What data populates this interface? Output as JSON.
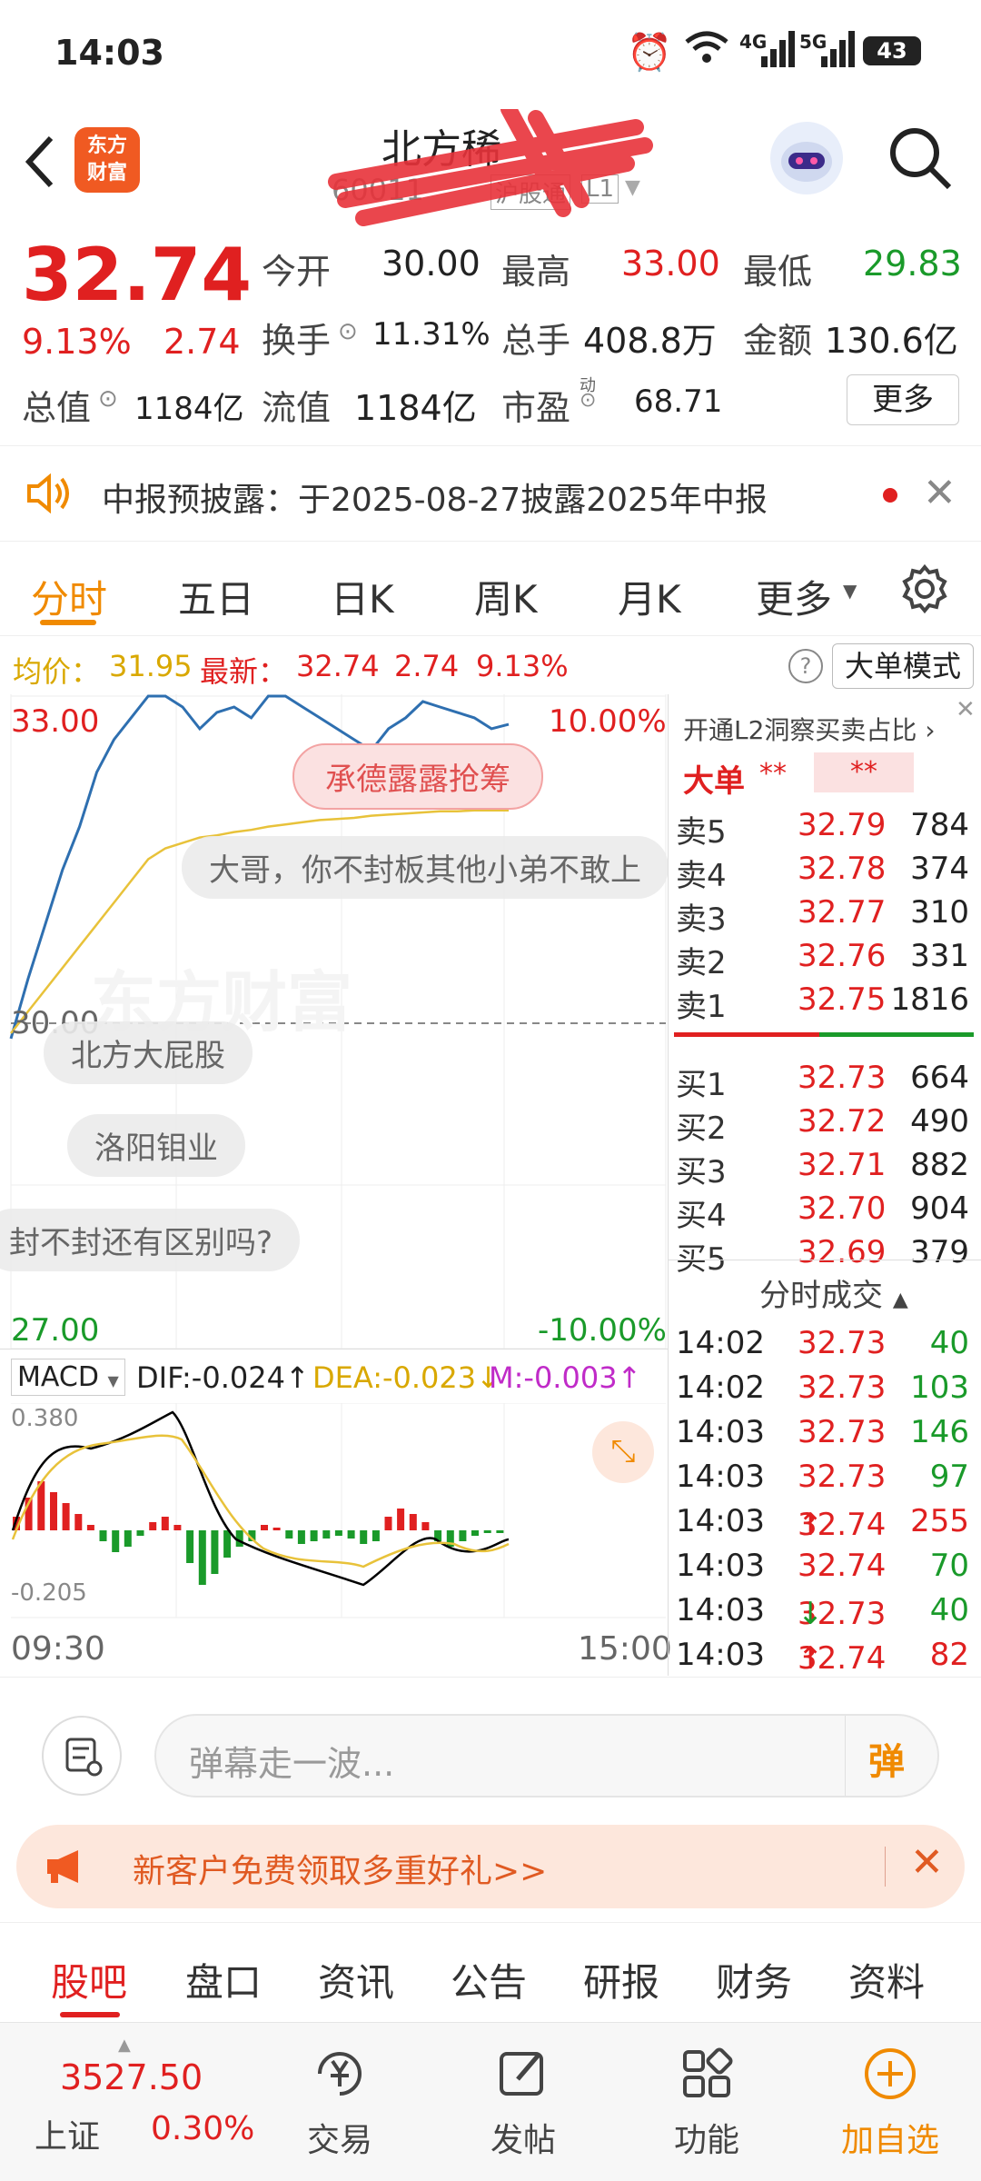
{
  "status": {
    "time": "14:03",
    "net1": "4G",
    "net2": "5G",
    "battery": "43"
  },
  "header": {
    "title": "北方稀",
    "code": "60011",
    "exchange": "沪股通",
    "level": "L1"
  },
  "quote": {
    "price": "32.74",
    "change_pct": "9.13%",
    "change": "2.74",
    "open_label": "今开",
    "open": "30.00",
    "high_label": "最高",
    "high": "33.00",
    "low_label": "最低",
    "low": "29.83",
    "turnover_label": "换手",
    "turnover": "11.31%",
    "volume_label": "总手",
    "volume": "408.8万",
    "amount_label": "金额",
    "amount": "130.6亿",
    "mktcap_label": "总值",
    "mktcap": "1184亿",
    "float_label": "流值",
    "float": "1184亿",
    "pe_label": "市盈",
    "pe_sup": "动",
    "pe": "68.71",
    "more_button": "更多"
  },
  "notice": {
    "text": "中报预披露：于2025-08-27披露2025年中报"
  },
  "ktabs": {
    "items": [
      "分时",
      "五日",
      "日K",
      "周K",
      "月K",
      "更多"
    ],
    "active": 0
  },
  "infobar": {
    "avg_label": "均价：",
    "avg": "31.95",
    "latest_label": "最新：",
    "latest": "32.74",
    "chg": "2.74",
    "pct": "9.13%",
    "mode_button": "大单模式"
  },
  "chart_data": {
    "type": "line",
    "y_top": "33.00",
    "y_mid": "30.00",
    "y_bottom": "27.00",
    "pct_top": "10.00%",
    "pct_bottom": "-10.00%",
    "x_start": "09:30",
    "x_end": "15:00",
    "ylim": [
      27.0,
      33.0
    ],
    "series": [
      {
        "values": [
          29.85,
          30.4,
          30.9,
          31.4,
          31.8,
          32.3,
          32.6,
          32.8,
          33.0,
          33.0,
          32.9,
          32.7,
          32.85,
          32.9,
          32.8,
          33.0,
          33.0,
          32.9,
          32.8,
          32.7,
          32.6,
          32.5,
          32.7,
          32.8,
          32.95,
          32.9,
          32.85,
          32.8,
          32.7,
          32.74
        ]
      },
      {
        "values": [
          29.9,
          30.1,
          30.3,
          30.5,
          30.7,
          30.9,
          31.1,
          31.3,
          31.5,
          31.6,
          31.65,
          31.7,
          31.72,
          31.75,
          31.77,
          31.8,
          31.82,
          31.84,
          31.86,
          31.87,
          31.88,
          31.9,
          31.91,
          31.92,
          31.93,
          31.94,
          31.94,
          31.95,
          31.95,
          31.95
        ]
      }
    ],
    "macd": {
      "label": "MACD",
      "dif": "DIF:-0.024",
      "dea": "DEA:-0.023",
      "m": "M:-0.003",
      "top": "0.380",
      "bottom": "-0.205",
      "bars": [
        0.05,
        0.12,
        0.18,
        0.14,
        0.1,
        0.06,
        0.02,
        -0.04,
        -0.08,
        -0.06,
        -0.02,
        0.03,
        0.05,
        0.02,
        -0.12,
        -0.2,
        -0.16,
        -0.1,
        -0.06,
        -0.04,
        0.02,
        0.01,
        -0.03,
        -0.05,
        -0.04,
        -0.03,
        -0.02,
        -0.03,
        -0.05,
        -0.04,
        0.05,
        0.08,
        0.06,
        0.03,
        -0.04,
        -0.06,
        -0.04,
        -0.02,
        -0.01,
        -0.01
      ]
    }
  },
  "danmaku": {
    "tag": "承德露露抢筹",
    "c1": "大哥，你不封板其他小弟不敢上",
    "c2": "北方大屁股",
    "c3": "洛阳钼业",
    "c4": "封不封还有区别吗?",
    "watermark": "东方财富"
  },
  "orderbook": {
    "title": "开通L2洞察买卖占比",
    "big_label": "大单",
    "big_v1": "**",
    "big_v2": "**",
    "asks": [
      {
        "label": "卖5",
        "price": "32.79",
        "vol": "784"
      },
      {
        "label": "卖4",
        "price": "32.78",
        "vol": "374"
      },
      {
        "label": "卖3",
        "price": "32.77",
        "vol": "310"
      },
      {
        "label": "卖2",
        "price": "32.76",
        "vol": "331"
      },
      {
        "label": "卖1",
        "price": "32.75",
        "vol": "1816"
      }
    ],
    "bids": [
      {
        "label": "买1",
        "price": "32.73",
        "vol": "664"
      },
      {
        "label": "买2",
        "price": "32.72",
        "vol": "490"
      },
      {
        "label": "买3",
        "price": "32.71",
        "vol": "882"
      },
      {
        "label": "买4",
        "price": "32.70",
        "vol": "904"
      },
      {
        "label": "买5",
        "price": "32.69",
        "vol": "379"
      }
    ],
    "trades_title": "分时成交",
    "trades": [
      {
        "time": "14:02",
        "price": "32.73",
        "vol": "40",
        "arrow": ""
      },
      {
        "time": "14:02",
        "price": "32.73",
        "vol": "103",
        "arrow": ""
      },
      {
        "time": "14:03",
        "price": "32.73",
        "vol": "146",
        "arrow": ""
      },
      {
        "time": "14:03",
        "price": "32.73",
        "vol": "97",
        "arrow": ""
      },
      {
        "time": "14:03",
        "price": "32.74",
        "vol": "255",
        "arrow": "↑"
      },
      {
        "time": "14:03",
        "price": "32.74",
        "vol": "70",
        "arrow": ""
      },
      {
        "time": "14:03",
        "price": "32.73",
        "vol": "40",
        "arrow": "↓"
      },
      {
        "time": "14:03",
        "price": "32.74",
        "vol": "82",
        "arrow": "↑"
      }
    ]
  },
  "comment": {
    "placeholder": "弹幕走一波...",
    "dm_button": "弹"
  },
  "promo": {
    "text": "新客户免费领取多重好礼>>"
  },
  "subtabs": {
    "items": [
      "股吧",
      "盘口",
      "资讯",
      "公告",
      "研报",
      "财务",
      "资料"
    ],
    "active": 0
  },
  "bottomnav": {
    "index_value": "3527.50",
    "index_name": "上证",
    "index_pct": "0.30%",
    "trade": "交易",
    "post": "发帖",
    "func": "功能",
    "add": "加自选"
  },
  "colors": {
    "up": "#e02020",
    "down": "#1a9a2a",
    "accent": "#f08a00",
    "price_line": "#2e6fb0",
    "avg_line": "#e8c23a"
  }
}
